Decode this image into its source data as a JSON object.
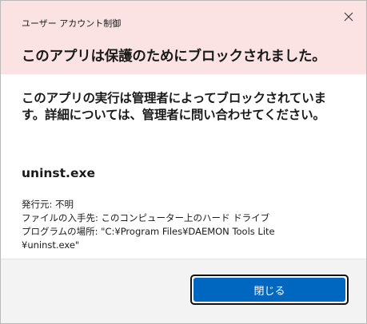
{
  "window": {
    "title": "ユーザー アカウント制御",
    "close_icon": "close-icon"
  },
  "header": {
    "headline": "このアプリは保護のためにブロックされました。"
  },
  "body": {
    "message": "このアプリの実行は管理者によってブロックされています。詳細については、管理者に問い合わせてください。",
    "filename": "uninst.exe",
    "details": [
      "発行元: 不明",
      "ファイルの入手先: このコンピューター上のハード ドライブ",
      "プログラムの場所: \"C:¥Program Files¥DAEMON Tools Lite",
      "¥uninst.exe\""
    ]
  },
  "footer": {
    "close_label": "閉じる"
  },
  "colors": {
    "header_bg": "#fbe3e4",
    "button_accent": "#0067c0"
  }
}
